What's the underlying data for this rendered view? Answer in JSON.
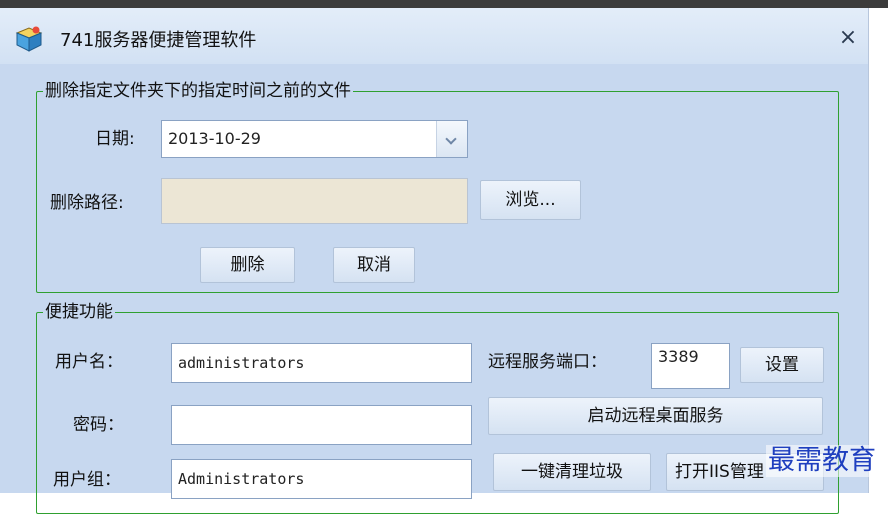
{
  "window": {
    "title": "741服务器便捷管理软件",
    "close_glyph": "×",
    "icon": "app-box-icon"
  },
  "delete_group": {
    "legend": "删除指定文件夹下的指定时间之前的文件",
    "date_label": "日期:",
    "date_value": "2013-10-29",
    "path_label": "删除路径:",
    "path_value": "",
    "browse_label": "浏览...",
    "delete_label": "删除",
    "cancel_label": "取消"
  },
  "quick_group": {
    "legend": "便捷功能",
    "username_label": "用户名：",
    "username_value": "administrators",
    "password_label": "密码：",
    "password_value": "",
    "usergroup_label": "用户组：",
    "usergroup_value": "Administrators",
    "port_label": "远程服务端口：",
    "port_value": "3389",
    "set_label": "设置",
    "start_remote_label": "启动远程桌面服务",
    "clean_label": "一键清理垃圾",
    "iis_label": "打开IIS管理"
  },
  "watermark": {
    "text": "最需教育"
  },
  "colors": {
    "window_bg": "#c7d8ef",
    "group_border": "#2fa030",
    "path_field_bg": "#ece6d5",
    "watermark": "#1f3fbf"
  }
}
